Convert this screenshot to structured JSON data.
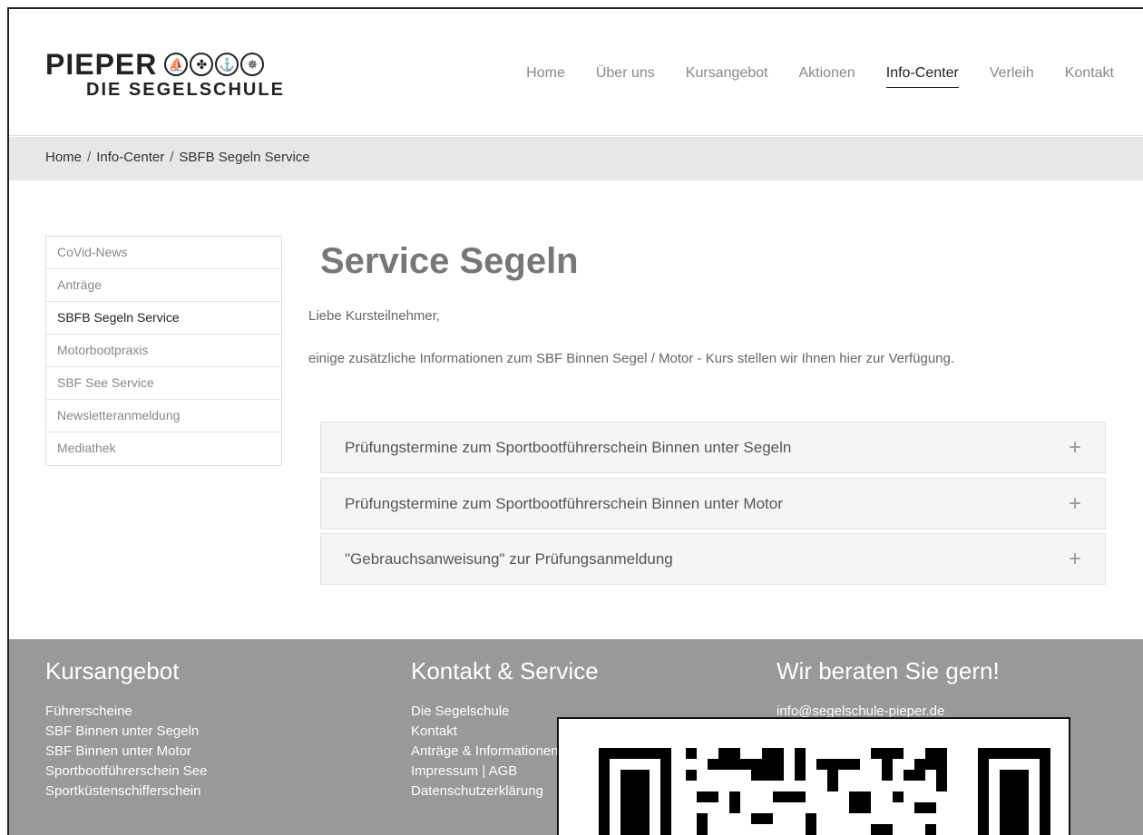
{
  "header": {
    "logo_name": "PIEPER",
    "logo_sub": "DIE SEGELSCHULE",
    "nav": [
      "Home",
      "Über uns",
      "Kursangebot",
      "Aktionen",
      "Info-Center",
      "Verleih",
      "Kontakt"
    ]
  },
  "breadcrumb": [
    "Home",
    "Info-Center",
    "SBFB Segeln Service"
  ],
  "sidebar": [
    "CoVid-News",
    "Anträge",
    "SBFB Segeln Service",
    "Motorbootpraxis",
    "SBF See Service",
    "Newsletteranmeldung",
    "Mediathek"
  ],
  "main": {
    "title": "Service Segeln",
    "p1": "Liebe Kursteilnehmer,",
    "p2": "einige zusätzliche Informationen zum SBF Binnen Segel / Motor - Kurs stellen wir Ihnen hier zur Verfügung.",
    "accordion": [
      "Prüfungstermine zum Sportbootführerschein Binnen unter Segeln",
      "Prüfungstermine zum Sportbootführerschein Binnen unter Motor",
      "\"Gebrauchsanweisung\" zur Prüfungsanmeldung"
    ],
    "plus": "+"
  },
  "footer": {
    "col1": {
      "title": "Kursangebot",
      "links": [
        "Führerscheine",
        "SBF Binnen unter Segeln",
        "SBF Binnen unter Motor",
        "Sportbootführerschein See",
        "Sportküstenschifferschein"
      ]
    },
    "col2": {
      "title": "Kontakt & Service",
      "links": [
        "Die Segelschule",
        "Kontakt",
        "Anträge & Informationen",
        "Impressum | AGB",
        "Datenschutzerklärung"
      ]
    },
    "col3": {
      "title": "Wir beraten Sie gern!",
      "links": [
        "info@segelschule-pieper.de"
      ]
    }
  },
  "colors": {
    "footer_bg": "#999999",
    "breadcrumb_bg": "#e7e7e7"
  }
}
